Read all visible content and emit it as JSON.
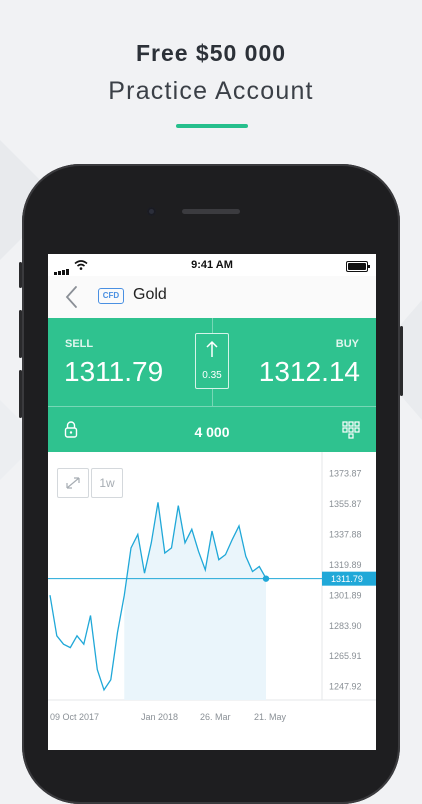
{
  "promo": {
    "headline": "Free $50 000",
    "subheadline": "Practice Account"
  },
  "colors": {
    "accent": "#26bf8c",
    "trade_panel": "#2fc28f",
    "chart_line": "#20a8d8",
    "badge_blue": "#4a90e2"
  },
  "status_bar": {
    "time": "9:41 AM"
  },
  "nav": {
    "badge": "CFD",
    "instrument": "Gold",
    "back_icon": "chevron-left-icon"
  },
  "trade": {
    "sell_label": "SELL",
    "sell_price": "1311.79",
    "buy_label": "BUY",
    "buy_price": "1312.14",
    "spread": "0.35",
    "quantity": "4 000",
    "lock_icon": "lock-icon",
    "keypad_icon": "keypad-icon"
  },
  "chart_toolbar": {
    "expand_icon": "expand-icon",
    "timeframe": "1w"
  },
  "chart_data": {
    "type": "line",
    "title": "",
    "xlabel": "",
    "ylabel": "",
    "x_ticks": [
      "09 Oct 2017",
      "Jan 2018",
      "26. Mar",
      "21. May"
    ],
    "y_ticks": [
      1373.87,
      1355.87,
      1337.88,
      1319.89,
      1301.89,
      1283.9,
      1265.91,
      1247.92
    ],
    "y_tick_labels": [
      "1373.87",
      "1355.87",
      "1337.88",
      "1319.89",
      "1301.89",
      "1283.90",
      "1265.91",
      "1247.92"
    ],
    "ylim": [
      1240,
      1382
    ],
    "current_price": 1311.79,
    "current_price_label": "1311.79",
    "series": [
      {
        "values": [
          1302,
          1278,
          1273,
          1271,
          1278,
          1273,
          1290,
          1258,
          1246,
          1252,
          1280,
          1302,
          1330,
          1338,
          1315,
          1333,
          1357,
          1327,
          1330,
          1355,
          1333,
          1341,
          1328,
          1317,
          1340,
          1323,
          1326,
          1335,
          1343,
          1325,
          1316,
          1319,
          1312
        ]
      }
    ],
    "grid": false,
    "legend": "none"
  }
}
